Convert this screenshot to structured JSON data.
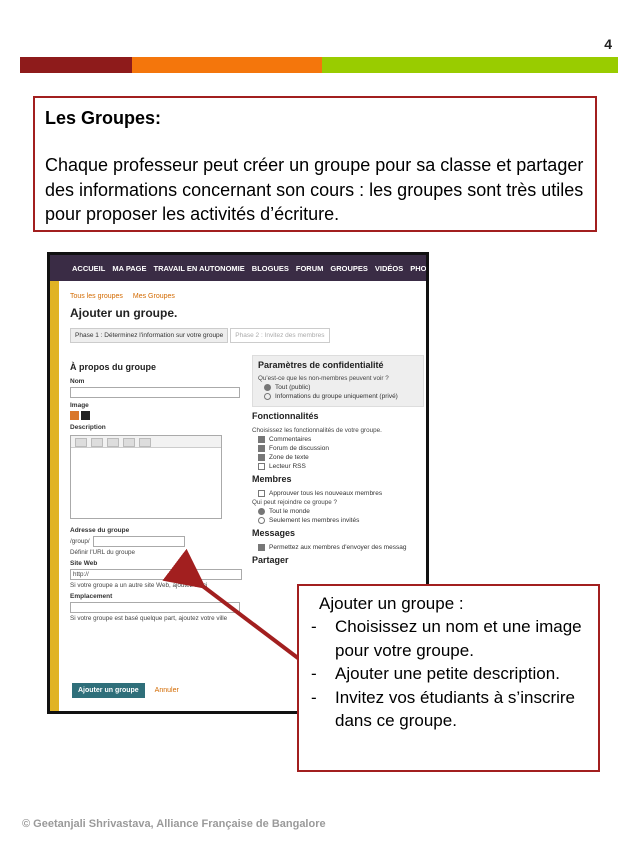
{
  "page_number": "4",
  "colors": {
    "bar1": "#8e1b1b",
    "bar2": "#f4760c",
    "bar3": "#99cc00",
    "box_border": "#a21f1f"
  },
  "intro": {
    "title": "Les Groupes:",
    "text": "Chaque professeur peut créer un groupe  pour sa classe et partager des informations concernant son cours : les groupes sont très utiles pour proposer les activités d’écriture."
  },
  "screenshot": {
    "nav": [
      "ACCUEIL",
      "MA PAGE",
      "TRAVAIL EN AUTONOMIE",
      "BLOGUES",
      "FORUM",
      "GROUPES",
      "VIDÉOS",
      "PHOTO"
    ],
    "breadcrumbs": [
      "Tous les groupes",
      "Mes Groupes"
    ],
    "heading": "Ajouter un groupe.",
    "phase1": "Phase 1 : Déterminez l'information sur votre groupe",
    "phase2": "Phase 2 : Invitez des membres",
    "about": {
      "title": "À propos du groupe",
      "nom": "Nom",
      "image": "Image",
      "description": "Description",
      "address_label": "Adresse du groupe",
      "address_value": "/group/",
      "address_hint": "Définir l'URL du groupe",
      "site_label": "Site Web",
      "site_value": "http://",
      "site_hint": "Si votre groupe a un autre site Web, ajoutez-le ici",
      "location_label": "Emplacement",
      "location_hint": "Si votre groupe est basé quelque part, ajoutez votre ville"
    },
    "privacy": {
      "title": "Paramètres de confidentialité",
      "question": "Qu'est-ce que les non-membres peuvent voir ?",
      "options": [
        "Tout (public)",
        "Informations du groupe uniquement (privé)"
      ]
    },
    "features": {
      "title": "Fonctionnalités",
      "hint": "Choisissez les fonctionnalités de votre groupe.",
      "options": [
        "Commentaires",
        "Forum de discussion",
        "Zone de texte",
        "Lecteur RSS"
      ]
    },
    "members": {
      "title": "Membres",
      "approve": "Approuver tous les nouveaux membres",
      "question": "Qui peut rejoindre ce groupe ?",
      "options": [
        "Tout le monde",
        "Seulement les membres invités"
      ]
    },
    "messages": {
      "title": "Messages",
      "option": "Permettez aux membres d'envoyer des messag"
    },
    "share": {
      "title": "Partager"
    },
    "buttons": {
      "submit": "Ajouter un groupe",
      "cancel": "Annuler"
    }
  },
  "callout": {
    "head": "Ajouter un groupe :",
    "items": [
      "Choisissez un nom et une image pour votre groupe.",
      "Ajouter une petite description.",
      "Invitez vos étudiants à s’inscrire dans ce groupe."
    ]
  },
  "footer": "© Geetanjali Shrivastava, Alliance Française de Bangalore"
}
